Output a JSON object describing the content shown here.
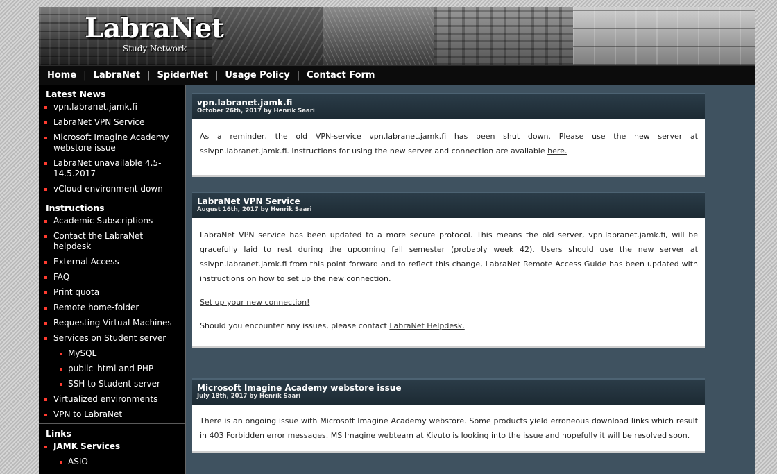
{
  "brand": {
    "title": "LabraNet",
    "subtitle": "Study Network"
  },
  "nav": {
    "items": [
      "Home",
      "LabraNet",
      "SpiderNet",
      "Usage Policy",
      "Contact Form"
    ],
    "separator": "|"
  },
  "sidebar": {
    "latest_news": {
      "heading": "Latest News",
      "items": [
        "vpn.labranet.jamk.fi",
        "LabraNet VPN Service",
        "Microsoft Imagine Academy webstore issue",
        "LabraNet unavailable 4.5-14.5.2017",
        "vCloud environment down"
      ]
    },
    "instructions": {
      "heading": "Instructions",
      "items": [
        "Academic Subscriptions",
        "Contact the LabraNet helpdesk",
        "External Access",
        "FAQ",
        "Print quota",
        "Remote home-folder",
        "Requesting Virtual Machines",
        "Services on Student server"
      ],
      "subitems": [
        "MySQL",
        "public_html and PHP",
        "SSH to Student server"
      ],
      "items_after": [
        "Virtualized environments",
        "VPN to LabraNet"
      ]
    },
    "links": {
      "heading": "Links",
      "group": "JAMK Services",
      "subitems": [
        "ASIO"
      ]
    }
  },
  "articles": [
    {
      "title": "vpn.labranet.jamk.fi",
      "meta": "October 26th, 2017 by Henrik Saari",
      "body_text": "As a reminder, the old VPN-service vpn.labranet.jamk.fi has been shut down. Please use the new server at sslvpn.labranet.jamk.fi. Instructions for using the new server and connection are available ",
      "body_link": "here."
    },
    {
      "title": "LabraNet VPN Service",
      "meta": "August 16th, 2017 by Henrik Saari",
      "p1": "LabraNet VPN service has been updated to a more secure protocol. This means the old server, vpn.labranet.jamk.fi, will be gracefully laid to rest during the upcoming fall semester (probably week 42). Users should use the new server at sslvpn.labranet.jamk.fi from this point forward and to reflect this change, LabraNet Remote Access Guide has been updated with instructions on how to set up the new connection.",
      "link": "Set up your new connection!",
      "p3_text": "Should you encounter any issues, please contact ",
      "p3_link": "LabraNet Helpdesk."
    },
    {
      "title": "Microsoft Imagine Academy webstore issue",
      "meta": "July 18th, 2017 by Henrik Saari",
      "body_text": "There is an ongoing issue with Microsoft Imagine Academy webstore. Some products yield erroneous download links which result in 403 Forbidden error messages. MS Imagine webteam at Kivuto is looking into the issue and hopefully it will be resolved soon."
    }
  ]
}
